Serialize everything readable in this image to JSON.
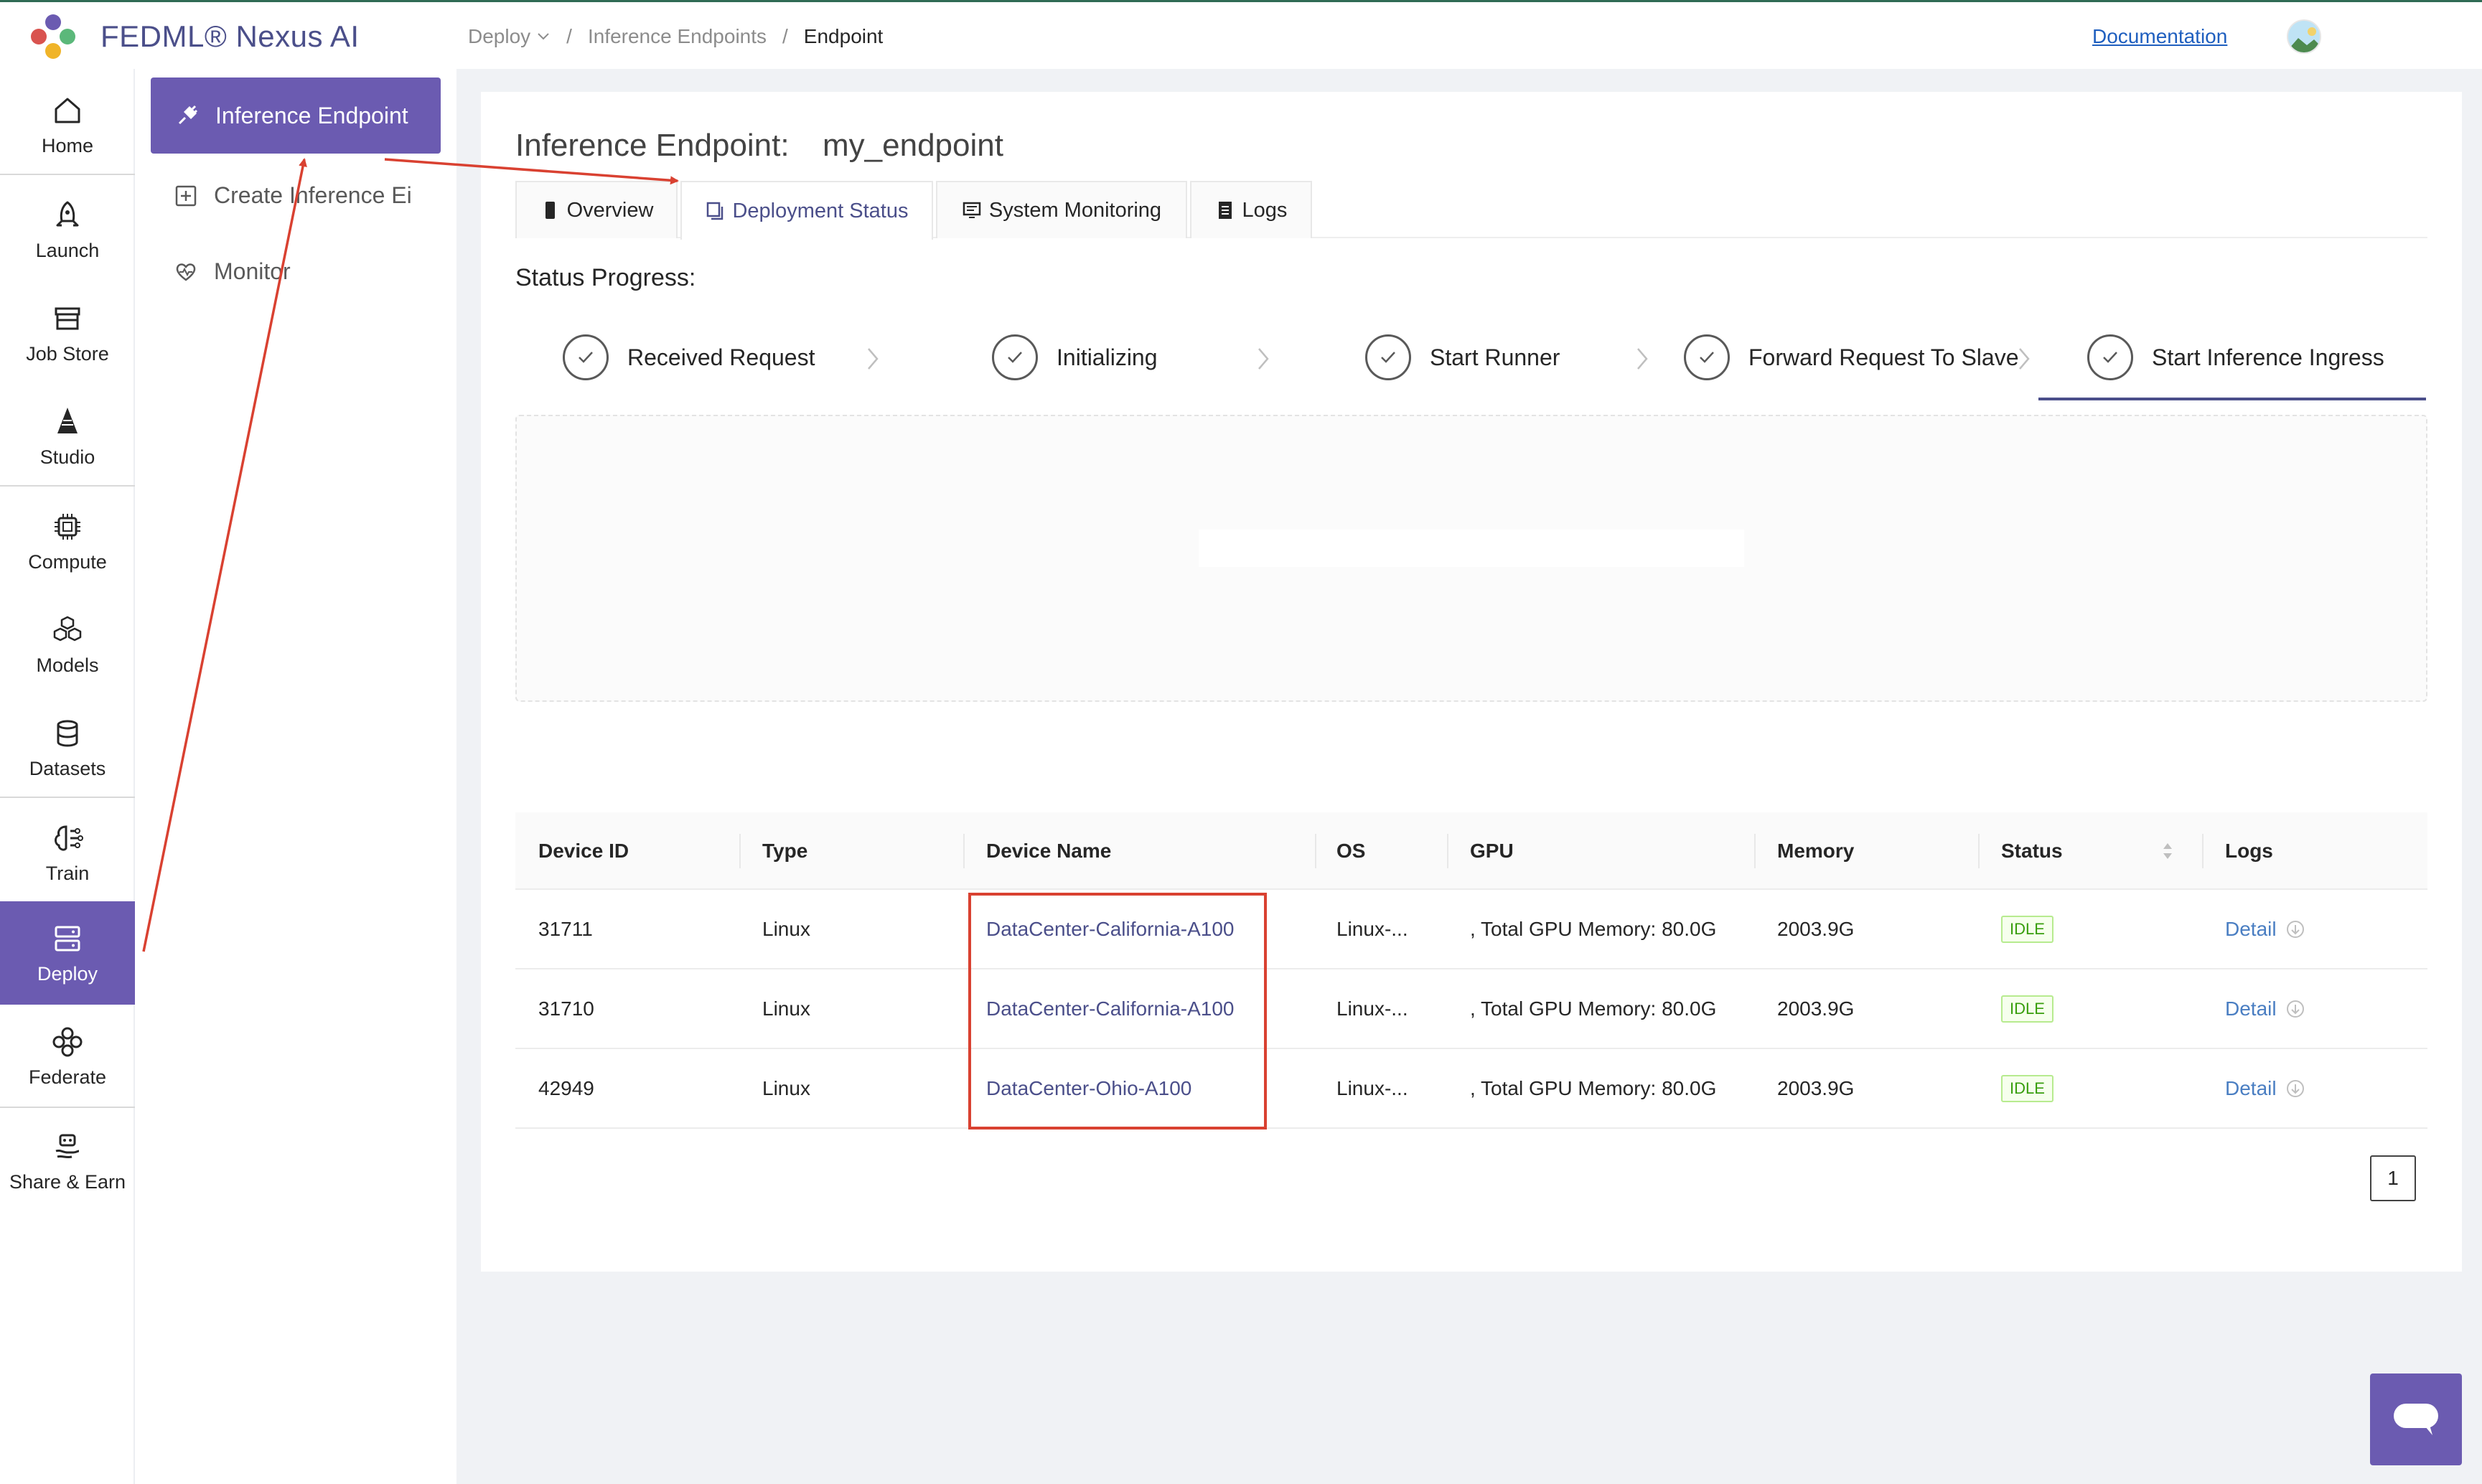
{
  "header": {
    "brand": "FEDML® Nexus AI",
    "breadcrumb": {
      "deploy": "Deploy",
      "endpoints": "Inference Endpoints",
      "current": "Endpoint"
    },
    "documentation": "Documentation"
  },
  "rail": {
    "items": [
      {
        "label": "Home",
        "icon": "home-icon"
      },
      {
        "label": "Launch",
        "icon": "rocket-icon"
      },
      {
        "label": "Job Store",
        "icon": "store-icon"
      },
      {
        "label": "Studio",
        "icon": "studio-icon"
      },
      {
        "label": "Compute",
        "icon": "chip-icon"
      },
      {
        "label": "Models",
        "icon": "cubes-icon"
      },
      {
        "label": "Datasets",
        "icon": "database-icon"
      },
      {
        "label": "Train",
        "icon": "brain-icon"
      },
      {
        "label": "Deploy",
        "icon": "server-icon",
        "active": true
      },
      {
        "label": "Federate",
        "icon": "federate-icon"
      },
      {
        "label": "Share & Earn",
        "icon": "share-earn-icon"
      }
    ]
  },
  "subnav": {
    "active": "Inference Endpoint",
    "create": "Create Inference Ei",
    "monitor": "Monitor"
  },
  "endpoint": {
    "title": "Inference Endpoint:",
    "name": "my_endpoint"
  },
  "tabs": {
    "overview": "Overview",
    "deployment_status": "Deployment Status",
    "system_monitoring": "System Monitoring",
    "logs": "Logs"
  },
  "status": {
    "label": "Status Progress:",
    "steps": [
      "Received Request",
      "Initializing",
      "Start Runner",
      "Forward Request To Slave",
      "Start Inference Ingress"
    ]
  },
  "table": {
    "columns": [
      "Device ID",
      "Type",
      "Device Name",
      "OS",
      "GPU",
      "Memory",
      "Status",
      "Logs"
    ],
    "rows": [
      {
        "id": "31711",
        "type": "Linux",
        "name": "DataCenter-California-A100",
        "os": "Linux-...",
        "gpu": ", Total GPU Memory: 80.0G",
        "memory": "2003.9G",
        "status": "IDLE",
        "logs": "Detail"
      },
      {
        "id": "31710",
        "type": "Linux",
        "name": "DataCenter-California-A100",
        "os": "Linux-...",
        "gpu": ", Total GPU Memory: 80.0G",
        "memory": "2003.9G",
        "status": "IDLE",
        "logs": "Detail"
      },
      {
        "id": "42949",
        "type": "Linux",
        "name": "DataCenter-Ohio-A100",
        "os": "Linux-...",
        "gpu": ", Total GPU Memory: 80.0G",
        "memory": "2003.9G",
        "status": "IDLE",
        "logs": "Detail"
      }
    ]
  },
  "pagination": {
    "current": "1"
  },
  "colors": {
    "accent": "#6b5bb1",
    "brand_text": "#4b4f8a",
    "annotation_red": "#d94131",
    "link": "#4a7ec2",
    "idle_green": "#389e0d"
  }
}
